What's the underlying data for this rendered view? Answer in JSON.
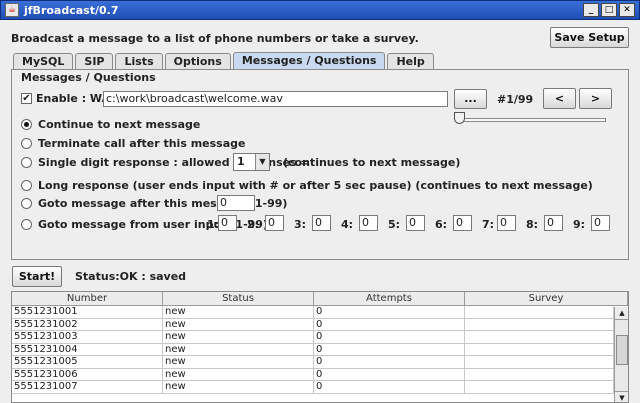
{
  "window": {
    "title": "jfBroadcast/0.7",
    "icon": "java-cup-icon",
    "controls": [
      "minimize",
      "maximize",
      "close"
    ]
  },
  "header": {
    "message": "Broadcast a message to a list of phone numbers or take a survey.",
    "save_button": "Save Setup"
  },
  "tabs": [
    {
      "label": "MySQL",
      "active": false
    },
    {
      "label": "SIP",
      "active": false
    },
    {
      "label": "Lists",
      "active": false
    },
    {
      "label": "Options",
      "active": false
    },
    {
      "label": "Messages / Questions",
      "active": true
    },
    {
      "label": "Help",
      "active": false
    }
  ],
  "messages": {
    "group_title": "Messages / Questions",
    "enable_label": "Enable : WAV=",
    "enable_checked": true,
    "wav_path": "c:\\work\\broadcast\\welcome.wav",
    "browse_button": "...",
    "counter": "#1/99",
    "prev_button": "<",
    "next_button": ">",
    "slider_value": 0,
    "options": {
      "continue": "Continue to next message",
      "terminate": "Terminate call after this message",
      "single_digit": "Single digit response : allowed responses =",
      "single_digit_value": "1",
      "single_digit_suffix": "(continues to next message)",
      "long_response": "Long response (user ends input with # or after 5 sec pause) (continues to next message)",
      "goto_after": "Goto message after this message (1-99)",
      "goto_after_value": "0",
      "goto_input": "Goto message from user input (1-99)"
    },
    "selected_option": "continue",
    "digit_gotos": [
      {
        "label": "1:",
        "value": "0"
      },
      {
        "label": "2:",
        "value": "0"
      },
      {
        "label": "3:",
        "value": "0"
      },
      {
        "label": "4:",
        "value": "0"
      },
      {
        "label": "5:",
        "value": "0"
      },
      {
        "label": "6:",
        "value": "0"
      },
      {
        "label": "7:",
        "value": "0"
      },
      {
        "label": "8:",
        "value": "0"
      },
      {
        "label": "9:",
        "value": "0"
      }
    ]
  },
  "controls": {
    "start_button": "Start!",
    "status": "Status:OK : saved"
  },
  "table": {
    "columns": [
      "Number",
      "Status",
      "Attempts",
      "Survey"
    ],
    "rows": [
      [
        "5551231001",
        "new",
        "0",
        ""
      ],
      [
        "5551231002",
        "new",
        "0",
        ""
      ],
      [
        "5551231003",
        "new",
        "0",
        ""
      ],
      [
        "5551231004",
        "new",
        "0",
        ""
      ],
      [
        "5551231005",
        "new",
        "0",
        ""
      ],
      [
        "5551231006",
        "new",
        "0",
        ""
      ],
      [
        "5551231007",
        "new",
        "0",
        ""
      ]
    ]
  }
}
